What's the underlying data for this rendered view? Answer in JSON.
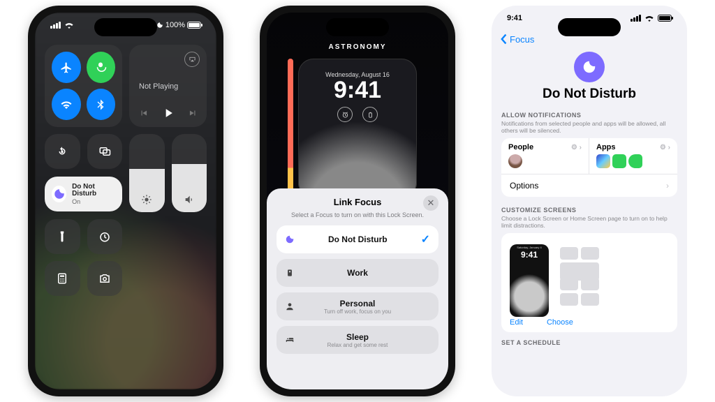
{
  "phone1": {
    "status": {
      "battery_pct": "100%"
    },
    "media": {
      "title": "Not Playing"
    },
    "dnd": {
      "title": "Do Not Disturb",
      "state": "On"
    }
  },
  "phone2": {
    "header": "ASTRONOMY",
    "lock": {
      "date": "Wednesday, August 16",
      "time": "9:41"
    },
    "sheet": {
      "title": "Link Focus",
      "subtitle": "Select a Focus to turn on with this Lock Screen.",
      "items": [
        {
          "label": "Do Not Disturb",
          "selected": true
        },
        {
          "label": "Work"
        },
        {
          "label": "Personal",
          "sub": "Turn off work, focus on you"
        },
        {
          "label": "Sleep",
          "sub": "Relax and get some rest"
        }
      ]
    }
  },
  "phone3": {
    "status": {
      "time": "9:41"
    },
    "back": "Focus",
    "title": "Do Not Disturb",
    "allow": {
      "caption": "ALLOW NOTIFICATIONS",
      "desc": "Notifications from selected people and apps will be allowed, all others will be silenced.",
      "people": "People",
      "apps": "Apps",
      "options": "Options"
    },
    "custom": {
      "caption": "CUSTOMIZE SCREENS",
      "desc": "Choose a Lock Screen or Home Screen page to turn on to help limit distractions.",
      "time": "9:41",
      "edit": "Edit",
      "choose": "Choose"
    },
    "schedule": {
      "caption": "SET A SCHEDULE"
    }
  }
}
